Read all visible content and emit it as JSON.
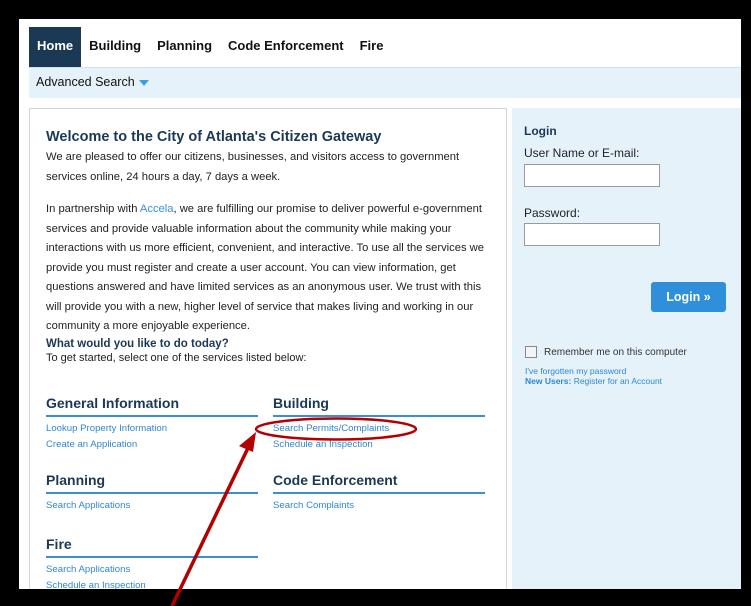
{
  "nav": {
    "tabs": [
      "Home",
      "Building",
      "Planning",
      "Code Enforcement",
      "Fire"
    ],
    "active": "Home",
    "sub_label": "Advanced Search"
  },
  "welcome": {
    "title": "Welcome to the City of Atlanta's Citizen Gateway",
    "p1": "We are pleased to offer our citizens, businesses, and visitors access to government services online, 24 hours a day, 7 days a week.",
    "p2_before": "In partnership with ",
    "p2_link": "Accela",
    "p2_after": ", we are fulfilling our promise to deliver powerful e-government services and provide valuable information about the community while making your interactions with us more efficient, convenient, and interactive. To use all the services we provide you must register and create a user account. You can view information, get questions answered and have limited services as an anonymous user. We trust with this will provide you with a new, higher level of service that makes living and working in our community a more enjoyable experience.",
    "question_title": "What would you like to do today?",
    "question_sub": "To get started, select one of the services listed below:"
  },
  "sections": [
    {
      "title": "General Information",
      "links": [
        "Lookup Property Information",
        "Create an Application"
      ]
    },
    {
      "title": "Building",
      "links": [
        "Search Permits/Complaints",
        "Schedule an Inspection"
      ]
    },
    {
      "title": "Planning",
      "links": [
        "Search Applications"
      ]
    },
    {
      "title": "Code Enforcement",
      "links": [
        "Search Complaints"
      ]
    },
    {
      "title": "Fire",
      "links": [
        "Search Applications",
        "Schedule an Inspection"
      ]
    }
  ],
  "login": {
    "title": "Login",
    "user_label": "User Name or E-mail:",
    "password_label": "Password:",
    "button": "Login »",
    "remember": "Remember me on this computer",
    "forgot": "I've forgotten my password",
    "new_users_label": "New Users:",
    "register": "Register for an Account"
  },
  "colors": {
    "annotation": "#b30000",
    "accent": "#2f8fdb",
    "nav_active": "#1b3855"
  }
}
